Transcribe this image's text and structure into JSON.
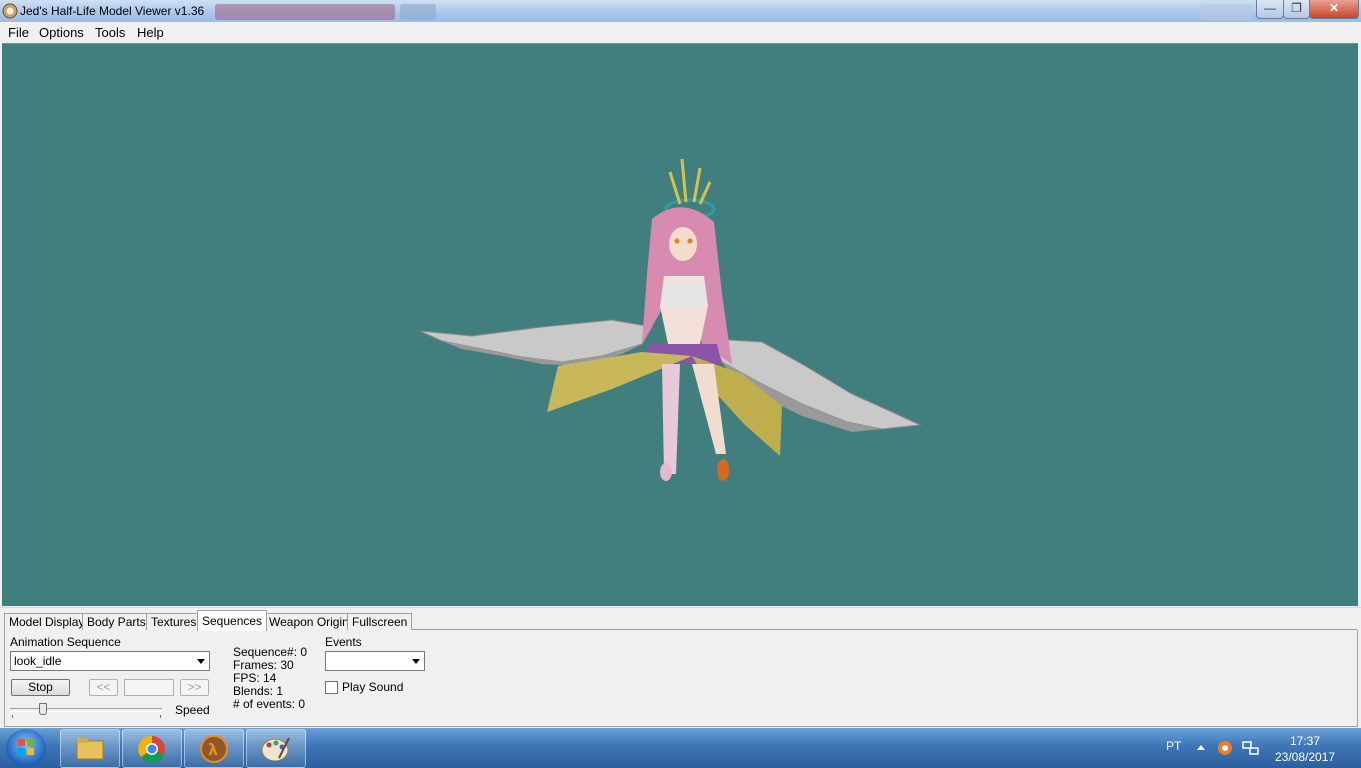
{
  "window": {
    "title": "Jed's Half-Life Model Viewer v1.36",
    "min_glyph": "—",
    "max_glyph": "❐",
    "close_glyph": "✕"
  },
  "menu": {
    "file": "File",
    "options": "Options",
    "tools": "Tools",
    "help": "Help"
  },
  "viewport": {
    "background": "#417f7f"
  },
  "tabs": {
    "model_display": "Model Display",
    "body_parts": "Body Parts",
    "textures": "Textures",
    "sequences": "Sequences",
    "weapon_origin": "Weapon Origin",
    "fullscreen": "Fullscreen",
    "active": "Sequences"
  },
  "sequences": {
    "animation_label": "Animation Sequence",
    "animation_value": "look_idle",
    "stop_label": "Stop",
    "prev_label": "<<",
    "next_label": ">>",
    "speed_label": "Speed",
    "speed_level": 0.2,
    "info_sequence": "Sequence#: 0",
    "info_frames": "Frames: 30",
    "info_fps": "FPS: 14",
    "info_blends": "Blends: 1",
    "info_events": "# of events: 0",
    "events_label": "Events",
    "events_value": "",
    "play_sound_label": "Play Sound",
    "play_sound_checked": false
  },
  "taskbar": {
    "items": [
      "windows-explorer",
      "google-chrome",
      "half-life",
      "paint"
    ],
    "language": "PT",
    "time": "17:37",
    "date": "23/08/2017"
  }
}
